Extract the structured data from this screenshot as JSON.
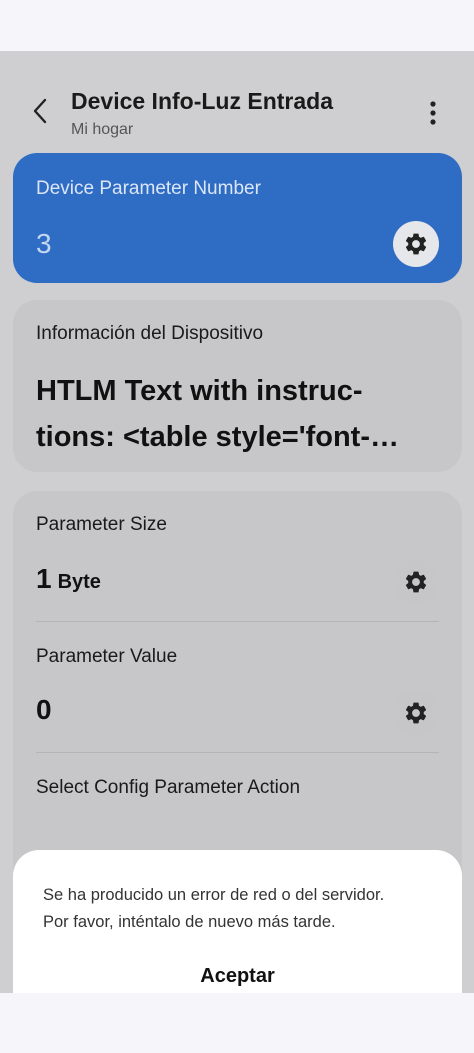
{
  "header": {
    "title": "Device Info-Luz Entrada",
    "subtitle": "Mi hogar"
  },
  "param_number": {
    "label": "Device Parameter Number",
    "value": "3"
  },
  "device_info": {
    "label": "Información del Dispositivo",
    "line1": "HTLM Text with instruc-",
    "line2": "tions: <table style='font-…"
  },
  "parameters": {
    "size": {
      "label": "Parameter Size",
      "value": "1",
      "unit": "Byte"
    },
    "value": {
      "label": "Parameter Value",
      "value": "0"
    },
    "action": {
      "label": "Select Config Parameter Action"
    }
  },
  "dialog": {
    "line1": "Se ha producido un error de red o del servidor.",
    "line2": "Por favor, inténtalo de nuevo más tarde.",
    "accept_label": "Aceptar"
  },
  "colors": {
    "accent": "#2f6cc4",
    "scrim_background": "#cfcfd1",
    "card": "#c7c7c9",
    "dialog": "#ffffff"
  },
  "icons": {
    "back": "back-arrow-icon",
    "more": "more-vertical-icon",
    "settings": "gear-icon"
  }
}
